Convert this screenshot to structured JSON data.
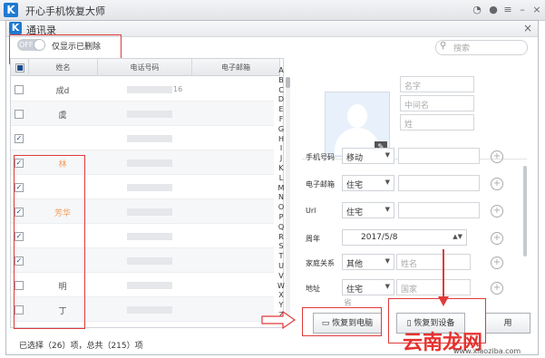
{
  "app": {
    "title": "开心手机恢复大师",
    "logo_letter": "K"
  },
  "window": {
    "title": "通讯录",
    "logo_letter": "K"
  },
  "toggle": {
    "state": "OFF",
    "label": "仅显示已删除"
  },
  "search": {
    "placeholder": "搜索"
  },
  "table": {
    "headers": [
      "姓名",
      "电话号码",
      "电子邮箱"
    ],
    "rows": [
      {
        "checked": false,
        "name": "成d",
        "phone_tail": "16",
        "deleted": false
      },
      {
        "checked": false,
        "name": "虞",
        "phone_tail": "",
        "deleted": false
      },
      {
        "checked": true,
        "name": "",
        "phone_tail": "",
        "deleted": true
      },
      {
        "checked": true,
        "name": "林",
        "phone_tail": "",
        "deleted": true
      },
      {
        "checked": true,
        "name": "",
        "phone_tail": "",
        "deleted": true
      },
      {
        "checked": true,
        "name": "芳华",
        "phone_tail": "",
        "deleted": true
      },
      {
        "checked": true,
        "name": "",
        "phone_tail": "",
        "deleted": true
      },
      {
        "checked": true,
        "name": "",
        "phone_tail": "",
        "deleted": true
      },
      {
        "checked": false,
        "name": "明",
        "phone_tail": "",
        "deleted": false
      },
      {
        "checked": false,
        "name": "丁",
        "phone_tail": "",
        "deleted": false
      }
    ],
    "alphabet": [
      "A",
      "B",
      "C",
      "D",
      "E",
      "F",
      "G",
      "H",
      "I",
      "J",
      "K",
      "L",
      "M",
      "N",
      "O",
      "P",
      "Q",
      "R",
      "S",
      "T",
      "U",
      "V",
      "W",
      "X",
      "Y",
      "Z"
    ]
  },
  "status": {
    "text": "已选择（26）项，总共（215）项"
  },
  "detail": {
    "name_placeholders": [
      "名字",
      "中间名",
      "姓"
    ],
    "phone": {
      "label": "手机号码",
      "type": "移动"
    },
    "email": {
      "label": "电子邮箱",
      "type": "住宅"
    },
    "url": {
      "label": "Url",
      "type": "住宅"
    },
    "anniversary": {
      "label": "周年",
      "date": "2017/5/8"
    },
    "family": {
      "label": "家庭关系",
      "type": "其他",
      "placeholder": "姓名"
    },
    "address": {
      "label": "地址",
      "type": "住宅",
      "placeholder": "国家",
      "next_hint": "省"
    }
  },
  "buttons": {
    "restore_pc": "恢复到电脑",
    "restore_phone": "恢复到设备",
    "extra": "用"
  },
  "watermark": {
    "main": "云南龙网",
    "sub": "www.xiaoziba.com"
  },
  "colors": {
    "accent": "#1e7ad1",
    "highlight": "#e03a3a",
    "deleted_name": "#f39a54"
  }
}
